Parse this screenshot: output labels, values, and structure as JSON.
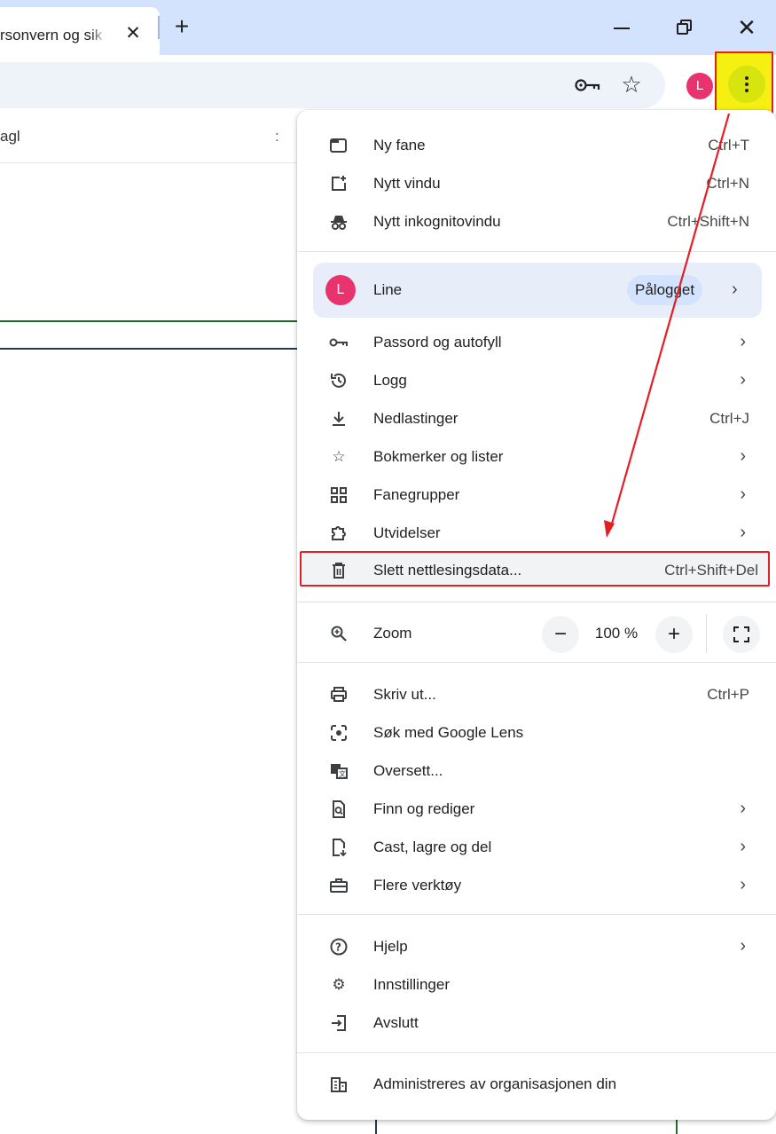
{
  "tab": {
    "title": "rsonvern og sik",
    "close_glyph": "✕",
    "new_tab_glyph": "+"
  },
  "window": {
    "minimize": "",
    "close_glyph": "✕"
  },
  "toolbar": {
    "avatar_letter": "L"
  },
  "page": {
    "bar_text": "agl",
    "bar_more": ":"
  },
  "menu": {
    "group1": [
      {
        "label": "Ny fane",
        "shortcut": "Ctrl+T",
        "icon": "new-tab-icon"
      },
      {
        "label": "Nytt vindu",
        "shortcut": "Ctrl+N",
        "icon": "new-window-icon"
      },
      {
        "label": "Nytt inkognitovindu",
        "shortcut": "Ctrl+Shift+N",
        "icon": "incognito-icon"
      }
    ],
    "profile": {
      "avatar_letter": "L",
      "name": "Line",
      "status": "Pålogget"
    },
    "group2": [
      {
        "label": "Passord og autofyll",
        "icon": "key-icon"
      },
      {
        "label": "Logg",
        "icon": "history-icon"
      },
      {
        "label": "Nedlastinger",
        "shortcut": "Ctrl+J",
        "icon": "download-icon"
      },
      {
        "label": "Bokmerker og lister",
        "icon": "star-icon"
      },
      {
        "label": "Fanegrupper",
        "icon": "tab-groups-icon"
      },
      {
        "label": "Utvidelser",
        "icon": "extensions-icon"
      },
      {
        "label": "Slett nettlesingsdata...",
        "shortcut": "Ctrl+Shift+Del",
        "icon": "trash-icon"
      }
    ],
    "zoom": {
      "label": "Zoom",
      "value": "100 %",
      "minus": "−",
      "plus": "+"
    },
    "group3": [
      {
        "label": "Skriv ut...",
        "shortcut": "Ctrl+P",
        "icon": "print-icon"
      },
      {
        "label": "Søk med Google Lens",
        "icon": "lens-icon"
      },
      {
        "label": "Oversett...",
        "icon": "translate-icon"
      },
      {
        "label": "Finn og rediger",
        "icon": "find-icon"
      },
      {
        "label": "Cast, lagre og del",
        "icon": "cast-icon"
      },
      {
        "label": "Flere verktøy",
        "icon": "toolbox-icon"
      }
    ],
    "group4": [
      {
        "label": "Hjelp",
        "icon": "help-icon"
      },
      {
        "label": "Innstillinger",
        "icon": "gear-icon"
      },
      {
        "label": "Avslutt",
        "icon": "exit-icon"
      }
    ],
    "managed": {
      "label": "Administreres av organisasjonen din",
      "icon": "building-icon"
    }
  },
  "colors": {
    "annotation_red": "#e31e24",
    "annotation_yellow": "#f5f011",
    "avatar": "#e8336f",
    "profile_bg": "#e8eef9"
  }
}
